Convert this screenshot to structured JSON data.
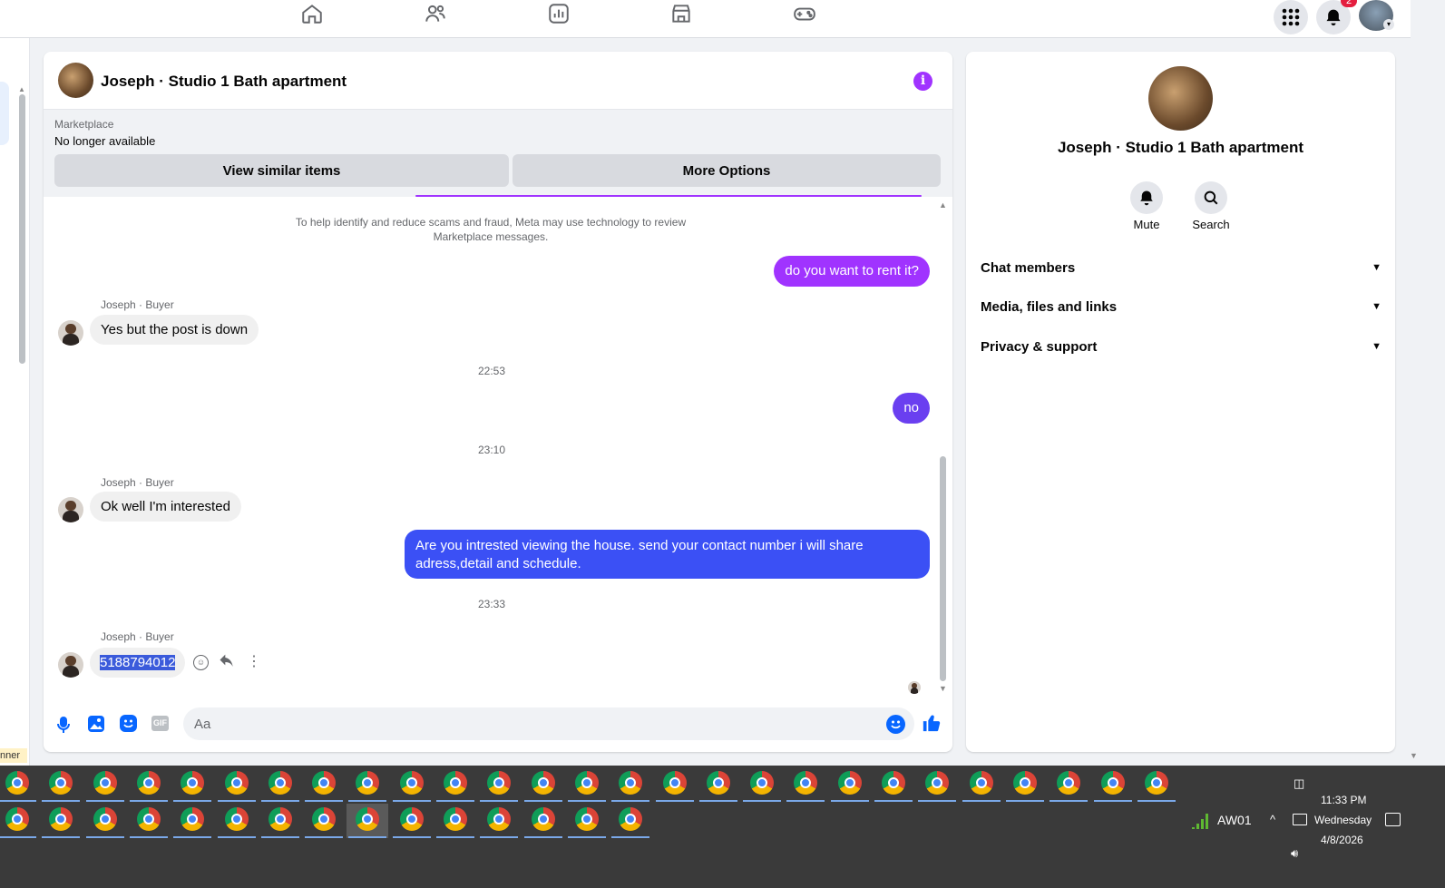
{
  "nav": {
    "icons": [
      "home-icon",
      "friends-icon",
      "dashboard-icon",
      "marketplace-icon",
      "gaming-icon"
    ],
    "notif_count": "2"
  },
  "chat": {
    "title": "Joseph · Studio 1 Bath apartment",
    "marketplace_label": "Marketplace",
    "status": "No longer available",
    "view_similar": "View similar items",
    "more_options": "More Options",
    "notice": "To help identify and reduce scams and fraud, Meta may use technology to review Marketplace messages.",
    "messages": {
      "out1": "do you want to rent it?",
      "sender1": "Joseph · Buyer",
      "in1": "Yes but the post is down",
      "time1": "22:53",
      "out2": "no",
      "time2": "23:10",
      "sender2": "Joseph · Buyer",
      "in2": "Ok well I'm interested",
      "out3": "Are you intrested viewing the house. send your contact number i will share adress,detail and schedule.",
      "time3": "23:33",
      "sender3": "Joseph · Buyer",
      "in3": "5188794012"
    },
    "composer_placeholder": "Aa"
  },
  "info": {
    "title": "Joseph · Studio 1 Bath apartment",
    "mute": "Mute",
    "search": "Search",
    "sections": [
      "Chat members",
      "Media, files and links",
      "Privacy & support"
    ]
  },
  "taskbar": {
    "network": "AW01",
    "time": "11:33 PM",
    "day": "Wednesday",
    "date": "4/8/2026",
    "corner_label": "nner"
  },
  "colors": {
    "accent": "#a033ff",
    "blue": "#3b50f5",
    "like": "#0866ff"
  }
}
